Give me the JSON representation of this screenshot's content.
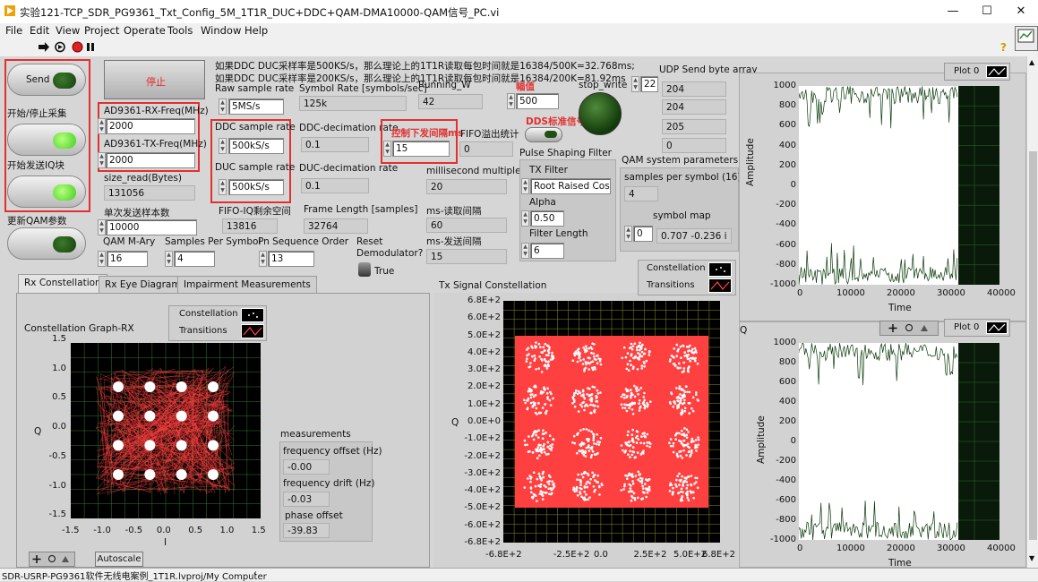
{
  "window": {
    "title": "实验121-TCP_SDR_PG9361_Txt_Config_5M_1T1R_DUC+DDC+QAM-DMA10000-QAM信号_PC.vi",
    "min": "—",
    "max": "☐",
    "close": "✕"
  },
  "menu": [
    "File",
    "Edit",
    "View",
    "Project",
    "Operate",
    "Tools",
    "Window",
    "Help"
  ],
  "buttons": {
    "send": "Send",
    "send_caption": "开始/停止采集",
    "iq_caption": "开始发送IQ块",
    "qam_caption": "更新QAM参数",
    "stop": "停止",
    "dds_label": "DDS标准信号",
    "stop_write": "stop_write"
  },
  "notes": {
    "line1": "如果DDC DUC采样率是500KS/s，那么理论上的1T1R读取每包时间就是16384/500K=32.768ms;",
    "line2": "如果DDC DUC采样率是200KS/s，那么理论上的1T1R读取每包时间就是16384/200K=81.92ms"
  },
  "fields": {
    "rx_freq": {
      "label": "AD9361-RX-Freq(MHz)",
      "value": "2000"
    },
    "tx_freq": {
      "label": "AD9361-TX-Freq(MHz)",
      "value": "2000"
    },
    "size_read": {
      "label": "size_read(Bytes)",
      "value": "131056"
    },
    "send_samples": {
      "label": "单次发送样本数",
      "value": "10000"
    },
    "raw_rate": {
      "label": "Raw sample rate",
      "value": "5MS/s"
    },
    "ddc_rate": {
      "label": "DDC sample rate",
      "value": "500kS/s"
    },
    "duc_rate": {
      "label": "DUC sample rate",
      "value": "500kS/s"
    },
    "fifo_iq": {
      "label": "FIFO-IQ剩余空间",
      "value": "13816"
    },
    "symbol_rate": {
      "label": "Symbol Rate [symbols/sec]",
      "value": "125k"
    },
    "running_w": {
      "label": "Running_W",
      "value": "42"
    },
    "amp": {
      "label": "幅值",
      "value": "500"
    },
    "ddc_dec": {
      "label": "DDC-decimation rate",
      "value": "0.1"
    },
    "duc_dec": {
      "label": "DUC-decimation rate",
      "value": "0.1"
    },
    "interval": {
      "label": "控制下发间隔ms",
      "value": "15"
    },
    "fifo_overflow": {
      "label": "FIFO溢出统计",
      "value": "0"
    },
    "frame_len": {
      "label": "Frame Length [samples]",
      "value": "32764"
    },
    "ms_mult": {
      "label": "millisecond multiple",
      "value": "20"
    },
    "ms_read": {
      "label": "ms-读取间隔",
      "value": "60"
    },
    "ms_send": {
      "label": "ms-发送间隔",
      "value": "15"
    },
    "qam_mary": {
      "label": "QAM M-Ary",
      "value": "16"
    },
    "sps": {
      "label": "Samples Per Symbol",
      "value": "4"
    },
    "pn": {
      "label": "Pn Sequence Order",
      "value": "13"
    },
    "reset_demod": {
      "label": "Reset Demodulator?",
      "value": "True"
    },
    "udp_count": "22",
    "udp_label": "UDP Send byte array",
    "udp_values": [
      "204",
      "204",
      "205",
      "0"
    ],
    "psf": {
      "title": "Pulse Shaping Filter",
      "tx_filter_label": "TX Filter",
      "tx_filter": "Root Raised Cos",
      "alpha_label": "Alpha",
      "alpha": "0.50",
      "flen_label": "Filter Length",
      "flen": "6"
    },
    "qam_sys": {
      "title": "QAM system parameters",
      "sps_label": "samples per symbol (16)",
      "sps": "4",
      "map_label": "symbol map",
      "map_index": "0",
      "map_value": "0.707 -0.236 i"
    }
  },
  "tabs": [
    "Rx Constellation",
    "Rx Eye Diagram",
    "Impairment Measurements"
  ],
  "rx_graph": {
    "title": "Constellation Graph-RX",
    "legend": [
      "Constellation",
      "Transitions"
    ],
    "ylabel": "Q",
    "xlabel": "I",
    "xticks": [
      "-1.5",
      "-1.0",
      "-0.5",
      "0.0",
      "0.5",
      "1.0",
      "1.5"
    ],
    "yticks": [
      "1.5",
      "1.0",
      "0.5",
      "0.0",
      "-0.5",
      "-1.0",
      "-1.5"
    ],
    "autoscale": "Autoscale"
  },
  "measurements": {
    "title": "measurements",
    "freq_offset_label": "frequency offset (Hz)",
    "freq_offset": "-0.00",
    "freq_drift_label": "frequency drift (Hz)",
    "freq_drift": "-0.03",
    "phase_label": "phase offset",
    "phase": "-39.83"
  },
  "tx_graph": {
    "title": "Tx Signal Constellation",
    "legend": [
      "Constellation",
      "Transitions"
    ],
    "ylabel": "Q",
    "yticks": [
      "6.8E+2",
      "6.0E+2",
      "5.0E+2",
      "4.0E+2",
      "3.0E+2",
      "2.0E+2",
      "1.0E+2",
      "0.0E+0",
      "-1.0E+2",
      "-2.0E+2",
      "-3.0E+2",
      "-4.0E+2",
      "-5.0E+2",
      "-6.0E+2",
      "-6.8E+2"
    ],
    "xticks": [
      "-6.8E+2",
      "-2.5E+2",
      "0.0",
      "2.5E+2",
      "5.0E+2",
      "6.8E+2"
    ]
  },
  "plots": {
    "i": {
      "legend": "Plot 0",
      "ylabel": "Amplitude",
      "xlabel": "Time",
      "yticks": [
        "1000",
        "800",
        "600",
        "400",
        "200",
        "0",
        "-200",
        "-400",
        "-600",
        "-800",
        "-1000"
      ],
      "xticks": [
        "0",
        "10000",
        "20000",
        "30000",
        "40000"
      ]
    },
    "q": {
      "legend": "Plot 0",
      "title": "Q",
      "ylabel": "Amplitude",
      "xlabel": "Time",
      "yticks": [
        "1000",
        "800",
        "600",
        "400",
        "200",
        "0",
        "-200",
        "-400",
        "-600",
        "-800",
        "-1000"
      ],
      "xticks": [
        "0",
        "10000",
        "20000",
        "30000",
        "40000"
      ]
    }
  },
  "status": "SDR-USRP-PG9361软件无线电案例_1T1R.lvproj/My Computer",
  "colors": {
    "accent_red": "#e23030",
    "trace_red": "#ff4040",
    "plot_white": "#ffffff",
    "grid_green": "#2f7a2f"
  }
}
